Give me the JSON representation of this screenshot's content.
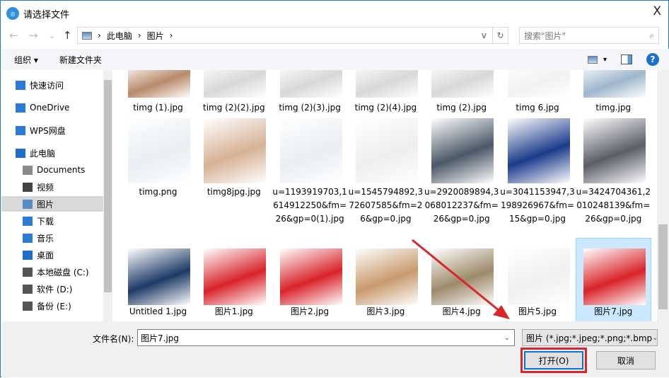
{
  "window": {
    "title": "请选择文件",
    "close": "X"
  },
  "nav": {
    "back": "←",
    "forward": "→",
    "recent": "⌄",
    "up": "↑"
  },
  "address": {
    "crumbs": [
      "此电脑",
      "图片"
    ],
    "sep": "›",
    "dropdown": "v",
    "refresh": "↻"
  },
  "search": {
    "placeholder": "搜索\"图片\"",
    "icon": "⌕"
  },
  "toolbar": {
    "organize": "组织 ▾",
    "new_folder": "新建文件夹",
    "view": "▾",
    "help": "?"
  },
  "sidebar": {
    "items": [
      {
        "label": "快速访问",
        "icon": "star-icon"
      },
      {
        "label": "OneDrive",
        "icon": "cloud-icon"
      },
      {
        "label": "WPS网盘",
        "icon": "cloud-icon"
      },
      {
        "label": "此电脑",
        "icon": "computer-icon"
      },
      {
        "label": "Documents",
        "icon": "document-icon"
      },
      {
        "label": "视频",
        "icon": "video-icon"
      },
      {
        "label": "图片",
        "icon": "picture-icon",
        "selected": true
      },
      {
        "label": "下载",
        "icon": "download-icon"
      },
      {
        "label": "音乐",
        "icon": "music-icon"
      },
      {
        "label": "桌面",
        "icon": "desktop-icon"
      },
      {
        "label": "本地磁盘 (C:)",
        "icon": "drive-icon"
      },
      {
        "label": "软件 (D:)",
        "icon": "drive-icon"
      },
      {
        "label": "备份 (E:)",
        "icon": "drive-icon"
      }
    ]
  },
  "files": [
    {
      "name": "timg (1).jpg",
      "color": "#b88a6a"
    },
    {
      "name": "timg (2)(2).jpg",
      "color": "#d8d8d8"
    },
    {
      "name": "timg (2)(3).jpg",
      "color": "#d8d8d8"
    },
    {
      "name": "timg (2)(4).jpg",
      "color": "#d8d8d8"
    },
    {
      "name": "timg (2).jpg",
      "color": "#d8d8d8"
    },
    {
      "name": "timg 6.jpg",
      "color": "#f2f2f2"
    },
    {
      "name": "timg.jpg",
      "color": "#9fb6cc"
    },
    {
      "name": "timg.png",
      "color": "#e8eef2"
    },
    {
      "name": "timg8jpg.jpg",
      "color": "#d6b296"
    },
    {
      "name": "u=1193919703,1614912250&fm=26&gp=0(1).jpg",
      "color": "#e9eef3"
    },
    {
      "name": "u=1545794892,372607585&fm=26&gp=0.jpg",
      "color": "#eeeeee"
    },
    {
      "name": "u=2920089894,3068012237&fm=26&gp=0.jpg",
      "color": "#4a5868"
    },
    {
      "name": "u=3041153947,3198926967&fm=15&gp=0.jpg",
      "color": "#1b3b8a"
    },
    {
      "name": "u=3424704361,2010248139&fm=26&gp=0.jpg",
      "color": "#5b5e68"
    },
    {
      "name": "Untitled 1.jpg",
      "color": "#1d3a66"
    },
    {
      "name": "图片1.jpg",
      "color": "#d9232a"
    },
    {
      "name": "图片2.jpg",
      "color": "#d9232a"
    },
    {
      "name": "图片3.jpg",
      "color": "#c89a6c"
    },
    {
      "name": "图片4.jpg",
      "color": "#9d8a6a"
    },
    {
      "name": "图片5.jpg",
      "color": "#f0f0f0"
    },
    {
      "name": "图片7.jpg",
      "color": "#d9232a",
      "selected": true
    }
  ],
  "bottom": {
    "filename_label": "文件名(N):",
    "filename_value": "图片7.jpg",
    "filetype": "图片 (*.jpg;*.jpeg;*.png;*.bmp",
    "open": "打开(O)",
    "cancel": "取消"
  },
  "colors": {
    "highlight": "#d9262c",
    "accent": "#0078d7",
    "selection": "#cce8ff"
  }
}
